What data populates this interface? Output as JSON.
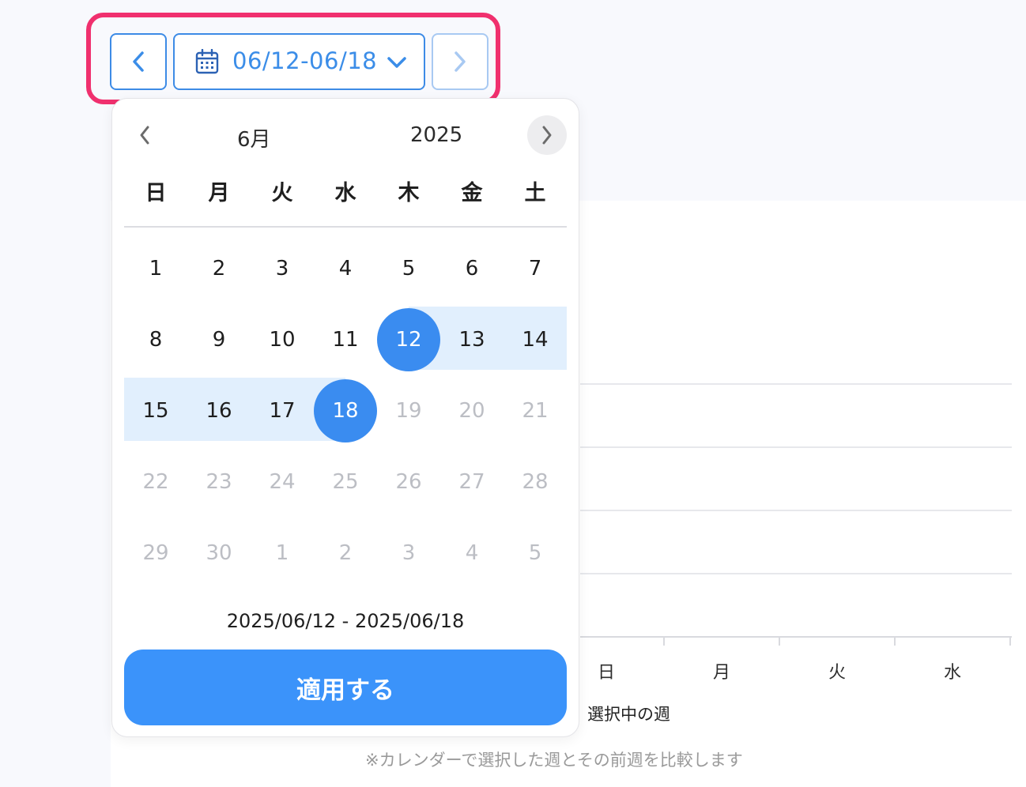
{
  "toolbar": {
    "range_label": "06/12-06/18"
  },
  "calendar": {
    "month": "6月",
    "year": "2025",
    "weekdays": [
      "日",
      "月",
      "火",
      "水",
      "木",
      "金",
      "土"
    ],
    "weeks": [
      [
        {
          "d": "1",
          "s": "n"
        },
        {
          "d": "2",
          "s": "n"
        },
        {
          "d": "3",
          "s": "n"
        },
        {
          "d": "4",
          "s": "n"
        },
        {
          "d": "5",
          "s": "n"
        },
        {
          "d": "6",
          "s": "n"
        },
        {
          "d": "7",
          "s": "n"
        }
      ],
      [
        {
          "d": "8",
          "s": "n"
        },
        {
          "d": "9",
          "s": "n"
        },
        {
          "d": "10",
          "s": "n"
        },
        {
          "d": "11",
          "s": "n"
        },
        {
          "d": "12",
          "s": "sel"
        },
        {
          "d": "13",
          "s": "range"
        },
        {
          "d": "14",
          "s": "range"
        }
      ],
      [
        {
          "d": "15",
          "s": "range"
        },
        {
          "d": "16",
          "s": "range"
        },
        {
          "d": "17",
          "s": "range"
        },
        {
          "d": "18",
          "s": "sel"
        },
        {
          "d": "19",
          "s": "dis"
        },
        {
          "d": "20",
          "s": "dis"
        },
        {
          "d": "21",
          "s": "dis"
        }
      ],
      [
        {
          "d": "22",
          "s": "dis"
        },
        {
          "d": "23",
          "s": "dis"
        },
        {
          "d": "24",
          "s": "dis"
        },
        {
          "d": "25",
          "s": "dis"
        },
        {
          "d": "26",
          "s": "dis"
        },
        {
          "d": "27",
          "s": "dis"
        },
        {
          "d": "28",
          "s": "dis"
        }
      ],
      [
        {
          "d": "29",
          "s": "dis"
        },
        {
          "d": "30",
          "s": "dis"
        },
        {
          "d": "1",
          "s": "dis"
        },
        {
          "d": "2",
          "s": "dis"
        },
        {
          "d": "3",
          "s": "dis"
        },
        {
          "d": "4",
          "s": "dis"
        },
        {
          "d": "5",
          "s": "dis"
        }
      ]
    ],
    "range_summary": "2025/06/12 - 2025/06/18",
    "apply_label": "適用する"
  },
  "chart": {
    "categories": [
      "日",
      "月",
      "火",
      "水"
    ],
    "legend": "選択中の週",
    "note": "※カレンダーで選択した週とその前週を比較します"
  },
  "colors": {
    "accent": "#3b8de8",
    "selected": "#3a8cf0",
    "range": "#e1effd",
    "highlight": "#f0306e"
  },
  "icons": {
    "prev": "chevron-left-icon",
    "next": "chevron-right-icon",
    "calendar": "calendar-icon",
    "dropdown": "chevron-down-icon"
  }
}
